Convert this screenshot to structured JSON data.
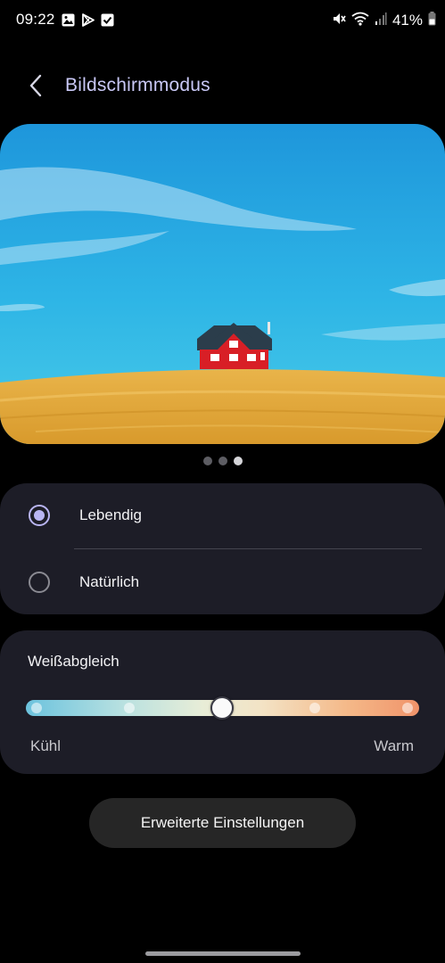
{
  "status_bar": {
    "time": "09:22",
    "notification_icons": [
      "image-icon",
      "play-store-icon",
      "checkbox-icon"
    ],
    "system_icons": [
      "mute-icon",
      "wifi-icon",
      "signal-icon"
    ],
    "battery_percent": "41%"
  },
  "header": {
    "title": "Bildschirmmodus",
    "back_icon": "chevron-left-icon"
  },
  "preview": {
    "image_description_icon": "preview-landscape",
    "page_count": 3,
    "active_page": 3
  },
  "screen_mode": {
    "options": [
      {
        "label": "Lebendig",
        "selected": true
      },
      {
        "label": "Natürlich",
        "selected": false
      }
    ]
  },
  "white_balance": {
    "title": "Weißabgleich",
    "min_label": "Kühl",
    "max_label": "Warm",
    "steps": 5,
    "value_step": 3,
    "gradient_colors": [
      "#6cc3de",
      "#e8edd7",
      "#f0936a"
    ]
  },
  "advanced_button": {
    "label": "Erweiterte Einstellungen"
  },
  "colors": {
    "accent": "#b9b5f3",
    "title": "#c9c8f6",
    "card": "#1d1d27",
    "background": "#000000"
  }
}
